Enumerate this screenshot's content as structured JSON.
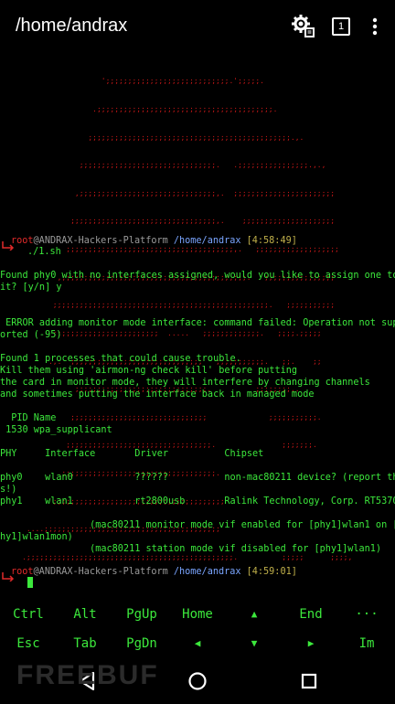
{
  "appbar": {
    "title": "/home/andrax",
    "sessions_count": "1"
  },
  "banner_art": [
    "                       ';;;;;;;;;;;;;;;;;;;;;;;;;;;;.';;;;;.",
    "                     .;;;;;;;;;;;;;;;;;;;;;;;;;;;;;;;;;;;;;;;;.",
    "                    ;;;;;;;;;;;;;;;;;;;;;;;;;;;;;;;;;;;;;;;;;;;;;;.,.",
    "                  ;;;;;;;;;;;;;;;;;;;;;;;;;;;;;;;.   .;;;;;;;;;;;;;;;;.,.,",
    "                 ,;;;;;;;;;;;;;;;;;;;;;;;;;;;;;;;,.  ;;;;;;;;;;;;;;;;;;;;;;;",
    "                ;;;;;;;;;;;;;;;;;;;;;;;;;;;;;;;;;,.    ;;;;;;;;;;;;;;;;;;;;;",
    "               ;;;;;;;;;;;;;;;;;;;;;;;;;;;;;;;;;;;;;;,.   ;;;;;;;;;;;;;;;;;;;",
    "             ,;;;;;;;;;;;;;;;;;;;;;;;;;;;;;;;;;;;;;;;;;;.   ;;;;;;;;;;;;;;;;",
    "            ;;;;;;;;;;;;;;;;;;;;;;;;;;;;;;;;;;;;;;;;;;;;;;;;;.   ;;;;;;;;;;;",
    "            ;;;;;;;;;;;;;;;;;;;;;;;;  .....   ;;;;;;;;;;;;;.   ;;;;.;;;;;",
    "           .,.  ;;;;;;;;;;;;;;;;;;;;;;;;;;;;;;   ;;;;;;;;;;;.   ;;.    ;;",
    "                 ;;;;;;;;;;;;;;;;;;;;;;;;;;;;;;.          ;;;;;;;;,.",
    "                ;;;;;;;;;;;;;;;;;;;;;;;;;;;;;;;              ;;;;;;;;;;;.",
    "               ;;;;;;;;;;;;;;;;;;;;;;;;;;;;;;;;;.               ;;;;;;;.",
    "             .;;;;;;;;;;;;;;;;;;;;;;;;;;;;;;;;;;;.",
    "            ;;;;;;;;;;;;;;;;;;;;;;;;;;;;;;;;;;;;;;;",
    "      ....;;;;;;;;;;;;;;;;;;;;;;;;;;;;;;;;;;;;;;;;",
    "     .;;;;;;;;;;;;;;;;;;;;;;;;;;;;;;;;;;;;;;;;;;;;;;;.          ;;;;;      ;;;;,"
  ],
  "terminal": {
    "prompt1": {
      "user": "root",
      "host": "@ANDRAX-Hackers-Platform",
      "path": "/home/andrax",
      "time": "[4:58:49]",
      "command": "./1.sh"
    },
    "lines": [
      "Found phy0 with no interfaces assigned, would you like to assign one to",
      "it? [y/n] y",
      " ERROR adding monitor mode interface: command failed: Operation not supp",
      "orted (-95)",
      "Found 1 processes that could cause trouble.",
      "Kill them using 'airmon-ng check kill' before putting",
      "the card in monitor mode, they will interfere by changing channels",
      "and sometimes putting the interface back in managed mode",
      "  PID Name",
      " 1530 wpa_supplicant",
      "PHY     Interface       Driver          Chipset",
      "phy0    wlan0           ??????          non-mac80211 device? (report thi",
      "s!)",
      "phy1    wlan1           rt2800usb       Ralink Technology, Corp. RT5370",
      "                (mac80211 monitor mode vif enabled for [phy1]wlan1 on [p",
      "hy1]wlan1mon)",
      "                (mac80211 station mode vif disabled for [phy1]wlan1)"
    ],
    "prompt2": {
      "user": "root",
      "host": "@ANDRAX-Hackers-Platform",
      "path": "/home/andrax",
      "time": "[4:59:01]"
    }
  },
  "extra_keys": {
    "row1": [
      "Ctrl",
      "Alt",
      "PgUp",
      "Home",
      "▲",
      "End",
      "···"
    ],
    "row2": [
      "Esc",
      "Tab",
      "PgDn",
      "◀",
      "▼",
      "▶",
      "Im"
    ]
  },
  "watermark": "FREEBUF",
  "colors": {
    "terminal_green": "#3ce83c",
    "art_red": "#cc1818",
    "path_blue": "#7aa5ff"
  }
}
